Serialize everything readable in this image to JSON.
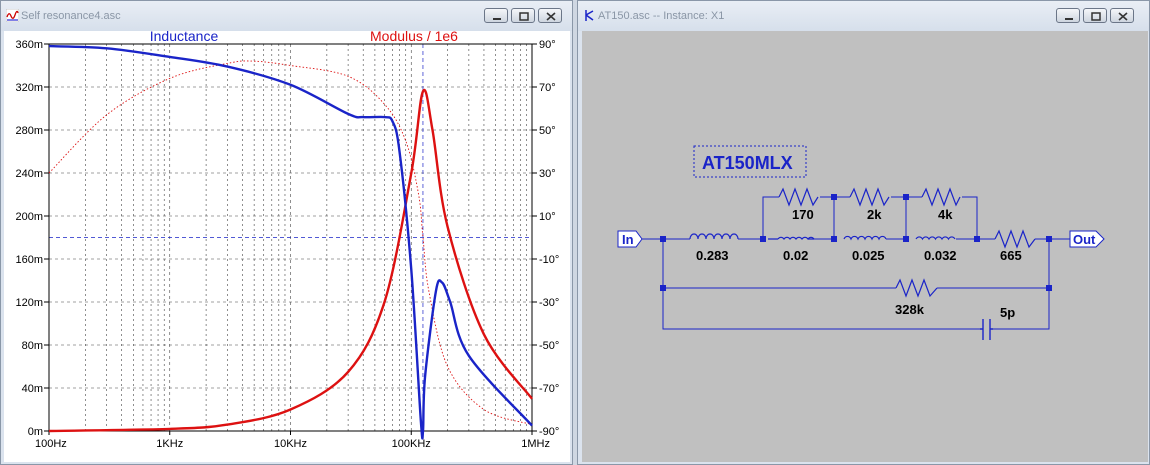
{
  "left_window": {
    "title": "Self resonance4.asc",
    "plot": {
      "trace_inductance_label": "Inductance",
      "trace_modulus_label": "Modulus / 1e6",
      "left_axis_ticks": [
        "360m",
        "320m",
        "280m",
        "240m",
        "200m",
        "160m",
        "120m",
        "80m",
        "40m",
        "0m"
      ],
      "right_axis_ticks": [
        "90°",
        "70°",
        "50°",
        "30°",
        "10°",
        "-10°",
        "-30°",
        "-50°",
        "-70°",
        "-90°"
      ],
      "x_axis_ticks": [
        "100Hz",
        "1KHz",
        "10KHz",
        "100KHz",
        "1MHz"
      ]
    }
  },
  "right_window": {
    "title": "AT150.asc -- Instance: X1",
    "schematic": {
      "component_name": "AT150MLX",
      "port_in": "In",
      "port_out": "Out",
      "inductors": [
        "0.283",
        "0.02",
        "0.025",
        "0.032"
      ],
      "resistors_top": [
        "170",
        "2k",
        "4k"
      ],
      "resistor_series": "665",
      "resistor_bypass": "328k",
      "capacitor": "5p"
    }
  },
  "colors": {
    "inductance_trace": "#1a24c8",
    "modulus_trace": "#dd1111",
    "schematic_wire": "#1a24c8",
    "schematic_bg": "#c0c0c0"
  },
  "chart_data": {
    "type": "line",
    "x_scale": "log",
    "xlim": [
      "100Hz",
      "1MHz"
    ],
    "ylim_left": [
      0,
      0.36
    ],
    "ylim_right": [
      -90,
      90
    ],
    "grid": true,
    "series": [
      {
        "name": "Inductance",
        "axis": "left",
        "style": "solid",
        "points": [
          [
            100,
            0.358
          ],
          [
            300,
            0.356
          ],
          [
            1000,
            0.348
          ],
          [
            3000,
            0.339
          ],
          [
            10000,
            0.322
          ],
          [
            30000,
            0.295
          ],
          [
            40000,
            0.292
          ],
          [
            60000,
            0.292
          ],
          [
            70000,
            0.288
          ],
          [
            80000,
            0.26
          ],
          [
            100000,
            0.15
          ],
          [
            120000,
            0.01
          ],
          [
            125000,
            0.0
          ],
          [
            130000,
            0.05
          ],
          [
            160000,
            0.13
          ],
          [
            180000,
            0.138
          ],
          [
            210000,
            0.12
          ],
          [
            300000,
            0.07
          ],
          [
            1000000,
            0.005
          ]
        ]
      },
      {
        "name": "Modulus / 1e6",
        "axis": "left",
        "style": "solid",
        "points": [
          [
            100,
            0.0
          ],
          [
            1000,
            0.002
          ],
          [
            3000,
            0.006
          ],
          [
            10000,
            0.02
          ],
          [
            30000,
            0.055
          ],
          [
            60000,
            0.12
          ],
          [
            100000,
            0.24
          ],
          [
            125000,
            0.316
          ],
          [
            150000,
            0.28
          ],
          [
            200000,
            0.19
          ],
          [
            400000,
            0.09
          ],
          [
            1000000,
            0.03
          ]
        ]
      },
      {
        "name": "",
        "axis": "right",
        "style": "dotted",
        "points": [
          [
            100,
            30
          ],
          [
            300,
            57
          ],
          [
            1000,
            74
          ],
          [
            3000,
            81
          ],
          [
            5000,
            82
          ],
          [
            10000,
            80
          ],
          [
            30000,
            75
          ],
          [
            60000,
            62
          ],
          [
            90000,
            45
          ],
          [
            115000,
            20
          ],
          [
            125000,
            0
          ],
          [
            140000,
            -25
          ],
          [
            200000,
            -60
          ],
          [
            400000,
            -80
          ],
          [
            1000000,
            -87
          ]
        ]
      }
    ]
  }
}
